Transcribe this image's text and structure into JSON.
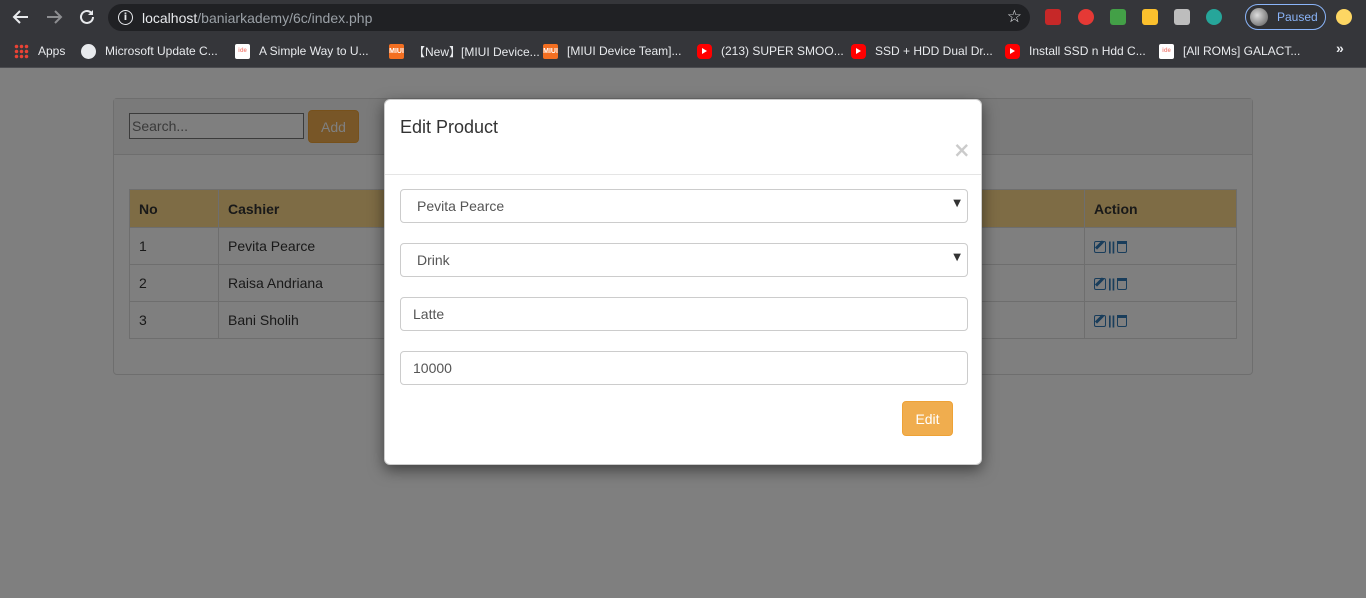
{
  "browser": {
    "url_host": "localhost",
    "url_path": "/baniarkademy/6c/index.php",
    "profile_status": "Paused",
    "bookmarks": [
      {
        "label": "Apps",
        "icon": "apps-grid-icon"
      },
      {
        "label": "Microsoft Update C...",
        "icon": "globe-icon"
      },
      {
        "label": "A Simple Way to U...",
        "icon": "ide-icon"
      },
      {
        "label": "【New】[MIUI Device...",
        "icon": "miui-icon"
      },
      {
        "label": "[MIUI Device Team]...",
        "icon": "miui-icon"
      },
      {
        "label": "(213) SUPER SMOO...",
        "icon": "youtube-icon"
      },
      {
        "label": "SSD + HDD Dual Dr...",
        "icon": "youtube-icon"
      },
      {
        "label": "Install SSD n Hdd C...",
        "icon": "youtube-icon"
      },
      {
        "label": "[All ROMs] GALACT...",
        "icon": "ide-icon"
      }
    ],
    "more_bookmarks": "»"
  },
  "toolbar": {
    "search_placeholder": "Search...",
    "add_label": "Add"
  },
  "table": {
    "headers": {
      "no": "No",
      "cashier": "Cashier",
      "action": "Action"
    },
    "rows": [
      {
        "no": "1",
        "cashier": "Pevita Pearce"
      },
      {
        "no": "2",
        "cashier": "Raisa Andriana"
      },
      {
        "no": "3",
        "cashier": "Bani Sholih"
      }
    ],
    "action_separator": "||"
  },
  "modal": {
    "title": "Edit Product",
    "close_symbol": "×",
    "cashier_selected": "Pevita Pearce",
    "category_selected": "Drink",
    "product_name_value": "Latte",
    "price_value": "10000",
    "edit_label": "Edit"
  },
  "colors": {
    "accent_warning": "#f0ad4e",
    "table_header": "#fcd98a",
    "link_blue": "#337ab7"
  }
}
